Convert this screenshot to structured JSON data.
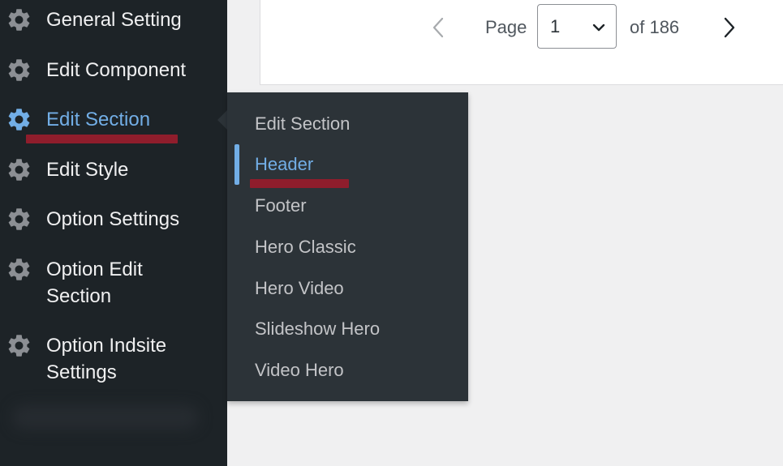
{
  "sidebar": {
    "items": [
      {
        "label": "General Setting",
        "icon": "gear-icon"
      },
      {
        "label": "Edit Component",
        "icon": "gear-icon"
      },
      {
        "label": "Edit Section",
        "icon": "gear-icon",
        "active": true
      },
      {
        "label": "Edit Style",
        "icon": "gear-icon"
      },
      {
        "label": "Option Settings",
        "icon": "gear-icon"
      },
      {
        "label": "Option Edit Section",
        "line1": "Option Edit",
        "line2": "Section",
        "icon": "gear-icon"
      },
      {
        "label": "Option Indsite Settings",
        "line1": "Option Indsite",
        "line2": "Settings",
        "icon": "gear-icon"
      }
    ]
  },
  "submenu": {
    "items": [
      {
        "label": "Edit Section"
      },
      {
        "label": "Header",
        "active": true
      },
      {
        "label": "Footer"
      },
      {
        "label": "Hero Classic"
      },
      {
        "label": "Hero Video"
      },
      {
        "label": "Slideshow Hero"
      },
      {
        "label": "Video Hero"
      }
    ]
  },
  "pagination": {
    "page_label": "Page",
    "current_page": "1",
    "of_label": "of 186",
    "prev_icon": "chevron-left-icon",
    "next_icon": "chevron-right-icon"
  },
  "colors": {
    "sidebar_bg": "#1d2327",
    "submenu_bg": "#2c3338",
    "accent": "#72aee6",
    "annotation_underline": "#8f1d2c",
    "content_bg": "#f0f0f1"
  }
}
